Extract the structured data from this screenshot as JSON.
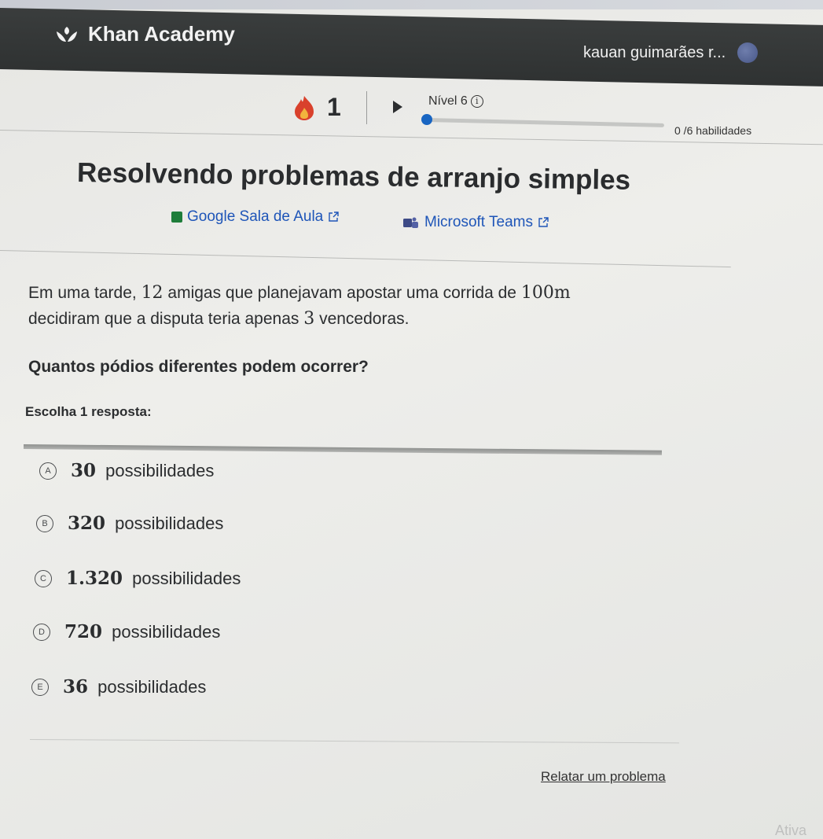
{
  "header": {
    "logo_text": "Khan Academy",
    "user_name": "kauan guimarães r..."
  },
  "progress": {
    "streak_count": "1",
    "level_label": "Nível 6",
    "skills_text": "0 /6 habilidades",
    "fraction": 0
  },
  "exercise": {
    "title": "Resolvendo problemas de arranjo simples",
    "share_google": "Google Sala de Aula",
    "share_teams": "Microsoft Teams",
    "problem": {
      "part1": "Em uma tarde, ",
      "num1": "12",
      "part2": " amigas que planejavam apostar uma corrida de ",
      "num2": "100m",
      "part3": "decidiram que a disputa teria apenas ",
      "num3": "3",
      "part4": " vencedoras."
    },
    "question": "Quantos pódios diferentes podem ocorrer?",
    "choose_label": "Escolha 1 resposta:",
    "choices": [
      {
        "letter": "A",
        "number": "30",
        "text": " possibilidades"
      },
      {
        "letter": "B",
        "number": "320",
        "text": " possibilidades"
      },
      {
        "letter": "C",
        "number": "1.320",
        "text": " possibilidades"
      },
      {
        "letter": "D",
        "number": "720",
        "text": " possibilidades"
      },
      {
        "letter": "E",
        "number": "36",
        "text": " possibilidades"
      }
    ],
    "report_link": "Relatar um problema"
  },
  "watermark": "Ativa",
  "colors": {
    "header_bg": "#2f3232",
    "link": "#1e55b8",
    "progress_dot": "#1865c2",
    "streak": "#d9412c"
  }
}
